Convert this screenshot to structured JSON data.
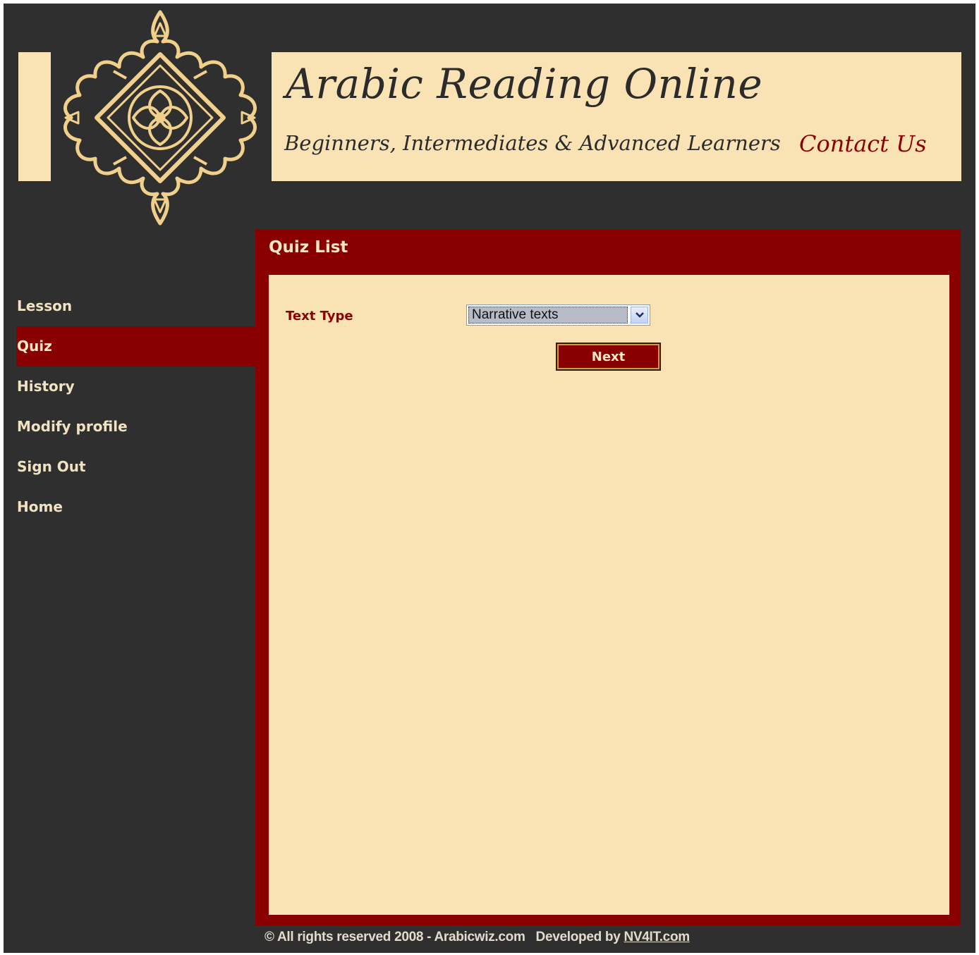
{
  "header": {
    "title": "Arabic Reading Online",
    "subtitle": "Beginners, Intermediates & Advanced Learners",
    "contact_label": "Contact Us",
    "logo_icon": "ornament-logo-icon"
  },
  "sidebar": {
    "items": [
      {
        "label": "Lesson",
        "active": false
      },
      {
        "label": "Quiz",
        "active": true
      },
      {
        "label": "History",
        "active": false
      },
      {
        "label": "Modify profile",
        "active": false
      },
      {
        "label": "Sign Out",
        "active": false
      },
      {
        "label": "Home",
        "active": false
      }
    ]
  },
  "main": {
    "panel_title": "Quiz List",
    "text_type_label": "Text Type",
    "text_type_value": "Narrative texts",
    "next_label": "Next"
  },
  "footer": {
    "copyright": "© All rights reserved 2008 - Arabicwiz.com",
    "developed_by": "Developed by",
    "developer_link": "NV4IT.com"
  },
  "colors": {
    "background": "#2f2f2f",
    "cream": "#f9e2b4",
    "accent": "#880000",
    "gold": "#f0d08a"
  }
}
